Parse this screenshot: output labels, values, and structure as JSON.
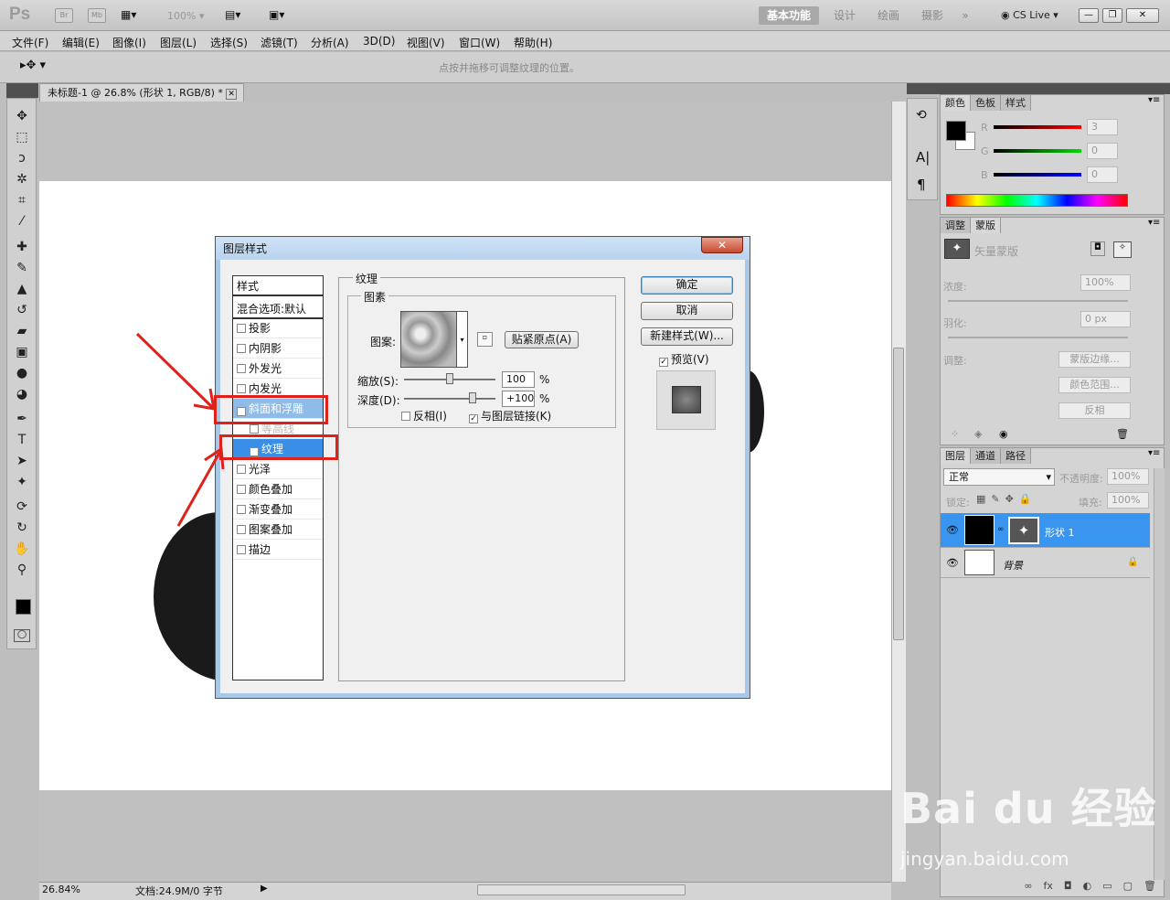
{
  "app": {
    "logo": "Ps",
    "icons": [
      "Br",
      "Mb"
    ],
    "zoom": "100%",
    "workspaces": [
      "基本功能",
      "设计",
      "绘画",
      "摄影"
    ],
    "more": "»",
    "cslive": "CS Live",
    "win_buttons": [
      "—",
      "❐",
      "✕"
    ]
  },
  "menu": [
    "文件(F)",
    "编辑(E)",
    "图像(I)",
    "图层(L)",
    "选择(S)",
    "滤镜(T)",
    "分析(A)",
    "3D(D)",
    "视图(V)",
    "窗口(W)",
    "帮助(H)"
  ],
  "options": {
    "hint": "点按并拖移可调整纹理的位置。"
  },
  "document": {
    "tab": "未标题-1 @ 26.8% (形状 1, RGB/8) *",
    "status_zoom": "26.84%",
    "status_doc": "文档:24.9M/0 字节"
  },
  "dialog": {
    "title": "图层样式",
    "close": "✕",
    "styles_header": "样式",
    "blend": "混合选项:默认",
    "styles": [
      {
        "label": "投影",
        "checked": false
      },
      {
        "label": "内阴影",
        "checked": false
      },
      {
        "label": "外发光",
        "checked": false
      },
      {
        "label": "内发光",
        "checked": false
      },
      {
        "label": "斜面和浮雕",
        "checked": true
      },
      {
        "label": "等高线",
        "checked": false
      },
      {
        "label": "纹理",
        "checked": true
      },
      {
        "label": "光泽",
        "checked": false
      },
      {
        "label": "颜色叠加",
        "checked": false
      },
      {
        "label": "渐变叠加",
        "checked": false
      },
      {
        "label": "图案叠加",
        "checked": false
      },
      {
        "label": "描边",
        "checked": false
      }
    ],
    "texture_title": "纹理",
    "elements_title": "图素",
    "pattern_label": "图案:",
    "snap_button": "贴紧原点(A)",
    "scale_label": "缩放(S):",
    "scale_value": "100",
    "scale_pct": 50,
    "depth_label": "深度(D):",
    "depth_value": "+100",
    "depth_pct": 100,
    "percent": "%",
    "invert_label": "反相(I)",
    "invert_checked": false,
    "link_label": "与图层链接(K)",
    "link_checked": true,
    "ok": "确定",
    "cancel": "取消",
    "new_style": "新建样式(W)...",
    "preview_label": "预览(V)",
    "preview_checked": true
  },
  "panels": {
    "color_tabs": [
      "颜色",
      "色板",
      "样式"
    ],
    "rgb": [
      {
        "l": "R",
        "v": "3",
        "c": "#c00000"
      },
      {
        "l": "G",
        "v": "0",
        "c": "#00a000"
      },
      {
        "l": "B",
        "v": "0",
        "c": "#0000c0"
      }
    ],
    "mask_tabs": [
      "调整",
      "蒙版"
    ],
    "vector_mask": "矢量蒙版",
    "density_label": "浓度:",
    "density_value": "100%",
    "feather_label": "羽化:",
    "feather_value": "0 px",
    "adjust_label": "调整:",
    "mask_edge": "蒙版边缘...",
    "color_range": "颜色范围...",
    "invert": "反相",
    "layer_tabs": [
      "图层",
      "通道",
      "路径"
    ],
    "blend_mode": "正常",
    "opacity_label": "不透明度:",
    "opacity_value": "100%",
    "lock_label": "锁定:",
    "fill_label": "填充:",
    "fill_value": "100%",
    "layers": [
      {
        "name": "形状 1",
        "selected": true
      },
      {
        "name": "背景",
        "selected": false
      }
    ],
    "layer_footer_icons": [
      "∞",
      "fx",
      "◘",
      "◐",
      "▭",
      "▢",
      "🗑"
    ]
  },
  "watermark": {
    "brand": "Bai du 经验",
    "url": "jingyan.baidu.com"
  }
}
